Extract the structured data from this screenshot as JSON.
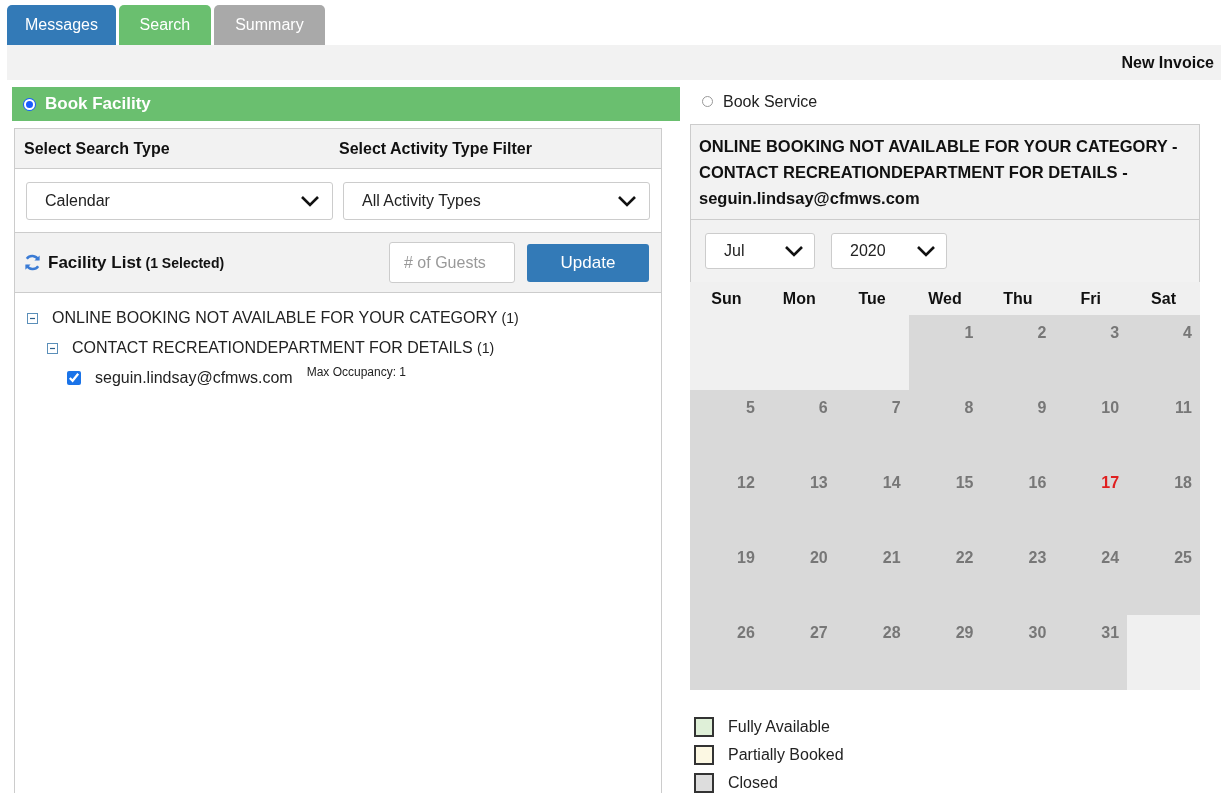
{
  "tabs": [
    {
      "label": "Messages",
      "selected": false,
      "disabled": false
    },
    {
      "label": "Search",
      "selected": true,
      "disabled": false
    },
    {
      "label": "Summary",
      "selected": false,
      "disabled": true
    }
  ],
  "header": {
    "title": "New Invoice"
  },
  "booking_modes": [
    {
      "label": "Book Facility",
      "selected": true
    },
    {
      "label": "Book Service",
      "selected": false
    }
  ],
  "search_panel": {
    "search_type_label": "Select Search Type",
    "activity_filter_label": "Select Activity Type Filter",
    "search_type": {
      "value": "Calendar"
    },
    "activity_filter": {
      "value": "All Activity Types"
    },
    "facility_list": {
      "title": "Facility List",
      "selected_count": "(1 Selected)"
    },
    "guests": {
      "placeholder": "# of Guests"
    },
    "update_button": "Update"
  },
  "facility_tree": [
    {
      "label": "ONLINE BOOKING NOT AVAILABLE FOR YOUR CATEGORY",
      "count": "(1)",
      "expanded": true,
      "children": [
        {
          "label": "CONTACT RECREATIONDEPARTMENT FOR DETAILS",
          "count": "(1)",
          "expanded": true,
          "children": [
            {
              "label": "seguin.lindsay@cfmws.com",
              "checked": true,
              "note": "Max Occupancy: 1"
            }
          ]
        }
      ]
    }
  ],
  "calendar": {
    "message": "ONLINE BOOKING NOT AVAILABLE FOR YOUR CATEGORY - CONTACT RECREATIONDEPARTMENT FOR DETAILS - seguin.lindsay@cfmws.com",
    "month": {
      "value": "Jul"
    },
    "year": {
      "value": "2020"
    },
    "weekdays": [
      "Sun",
      "Mon",
      "Tue",
      "Wed",
      "Thu",
      "Fri",
      "Sat"
    ],
    "weeks": [
      [
        {
          "kind": "blank"
        },
        {
          "kind": "blank"
        },
        {
          "kind": "blank"
        },
        {
          "kind": "day",
          "day": "1",
          "closed": true,
          "today": false
        },
        {
          "kind": "day",
          "day": "2",
          "closed": true,
          "today": false
        },
        {
          "kind": "day",
          "day": "3",
          "closed": true,
          "today": false
        },
        {
          "kind": "day",
          "day": "4",
          "closed": true,
          "today": false
        }
      ],
      [
        {
          "kind": "day",
          "day": "5",
          "closed": true,
          "today": false
        },
        {
          "kind": "day",
          "day": "6",
          "closed": true,
          "today": false
        },
        {
          "kind": "day",
          "day": "7",
          "closed": true,
          "today": false
        },
        {
          "kind": "day",
          "day": "8",
          "closed": true,
          "today": false
        },
        {
          "kind": "day",
          "day": "9",
          "closed": true,
          "today": false
        },
        {
          "kind": "day",
          "day": "10",
          "closed": true,
          "today": false
        },
        {
          "kind": "day",
          "day": "11",
          "closed": true,
          "today": false
        }
      ],
      [
        {
          "kind": "day",
          "day": "12",
          "closed": true,
          "today": false
        },
        {
          "kind": "day",
          "day": "13",
          "closed": true,
          "today": false
        },
        {
          "kind": "day",
          "day": "14",
          "closed": true,
          "today": false
        },
        {
          "kind": "day",
          "day": "15",
          "closed": true,
          "today": false
        },
        {
          "kind": "day",
          "day": "16",
          "closed": true,
          "today": false
        },
        {
          "kind": "day",
          "day": "17",
          "closed": true,
          "today": true
        },
        {
          "kind": "day",
          "day": "18",
          "closed": true,
          "today": false
        }
      ],
      [
        {
          "kind": "day",
          "day": "19",
          "closed": true,
          "today": false
        },
        {
          "kind": "day",
          "day": "20",
          "closed": true,
          "today": false
        },
        {
          "kind": "day",
          "day": "21",
          "closed": true,
          "today": false
        },
        {
          "kind": "day",
          "day": "22",
          "closed": true,
          "today": false
        },
        {
          "kind": "day",
          "day": "23",
          "closed": true,
          "today": false
        },
        {
          "kind": "day",
          "day": "24",
          "closed": true,
          "today": false
        },
        {
          "kind": "day",
          "day": "25",
          "closed": true,
          "today": false
        }
      ],
      [
        {
          "kind": "day",
          "day": "26",
          "closed": true,
          "today": false
        },
        {
          "kind": "day",
          "day": "27",
          "closed": true,
          "today": false
        },
        {
          "kind": "day",
          "day": "28",
          "closed": true,
          "today": false
        },
        {
          "kind": "day",
          "day": "29",
          "closed": true,
          "today": false
        },
        {
          "kind": "day",
          "day": "30",
          "closed": true,
          "today": false
        },
        {
          "kind": "day",
          "day": "31",
          "closed": true,
          "today": false
        },
        {
          "kind": "blank"
        }
      ]
    ],
    "legend": [
      {
        "label": "Fully Available",
        "color": "#dff0d8"
      },
      {
        "label": "Partially Booked",
        "color": "#fcf8e3"
      },
      {
        "label": "Closed",
        "color": "#dddddd"
      }
    ]
  }
}
